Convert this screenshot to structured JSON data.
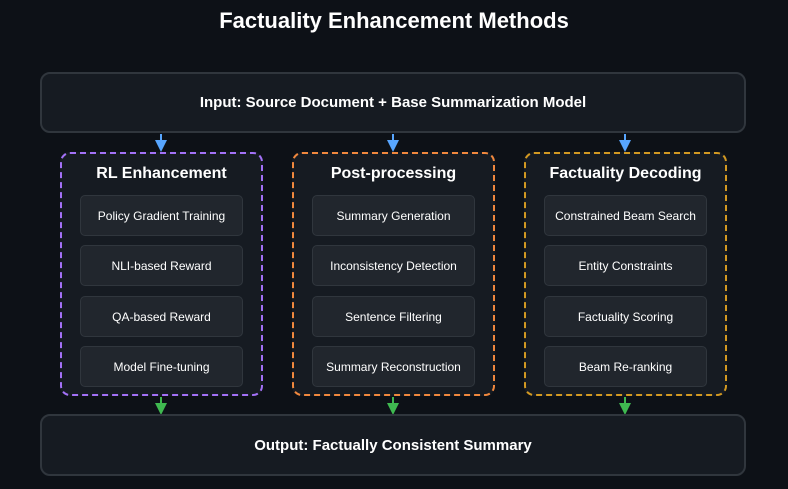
{
  "title": "Factuality Enhancement Methods",
  "input_label": "Input: Source Document + Base Summarization Model",
  "output_label": "Output: Factually Consistent Summary",
  "colors": {
    "background": "#0d1117",
    "bar_fill": "#161b22",
    "item_fill": "#21262d",
    "arrow_in": "#58a6ff",
    "arrow_out": "#3fb950"
  },
  "methods": [
    {
      "title": "RL Enhancement",
      "border_color": "#a371f7",
      "steps": [
        "Policy Gradient Training",
        "NLI-based Reward",
        "QA-based Reward",
        "Model Fine-tuning"
      ]
    },
    {
      "title": "Post-processing",
      "border_color": "#f0883e",
      "steps": [
        "Summary Generation",
        "Inconsistency Detection",
        "Sentence Filtering",
        "Summary Reconstruction"
      ]
    },
    {
      "title": "Factuality Decoding",
      "border_color": "#d29922",
      "steps": [
        "Constrained Beam Search",
        "Entity Constraints",
        "Factuality Scoring",
        "Beam Re-ranking"
      ]
    }
  ]
}
